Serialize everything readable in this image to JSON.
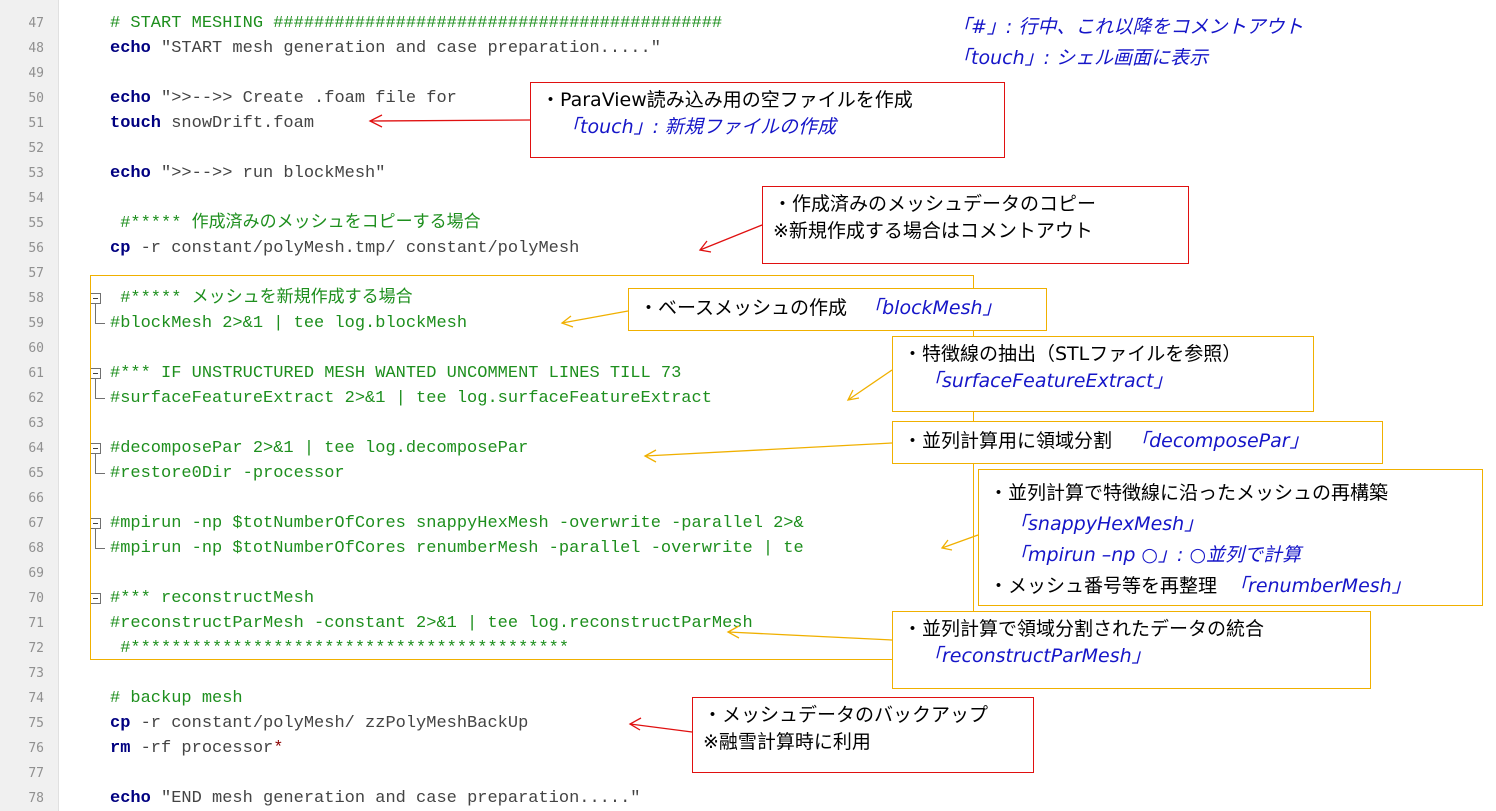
{
  "line_numbers": [
    "47",
    "48",
    "49",
    "50",
    "51",
    "52",
    "53",
    "54",
    "55",
    "56",
    "57",
    "58",
    "59",
    "60",
    "61",
    "62",
    "63",
    "64",
    "65",
    "66",
    "67",
    "68",
    "69",
    "70",
    "71",
    "72",
    "73",
    "74",
    "75",
    "76",
    "77",
    "78"
  ],
  "code": {
    "l47": "# START MESHING ############################################",
    "l48_kw": "echo",
    "l48_rest": " \"START mesh generation and case preparation.....\"",
    "l50_kw": "echo",
    "l50_rest": " \">>-->> Create .foam file for",
    "l51_kw": "touch",
    "l51_rest": " snowDrift.foam",
    "l53_kw": "echo",
    "l53_rest": " \">>-->> run blockMesh\"",
    "l55": " #***** 作成済みのメッシュをコピーする場合",
    "l56_kw": "cp",
    "l56_rest": " -r constant/polyMesh.tmp/ constant/polyMesh",
    "l58": " #***** メッシュを新規作成する場合",
    "l59": "#blockMesh 2>&1 | tee log.blockMesh",
    "l61": "#*** IF UNSTRUCTURED MESH WANTED UNCOMMENT LINES TILL 73",
    "l62": "#surfaceFeatureExtract 2>&1 | tee log.surfaceFeatureExtract",
    "l64": "#decomposePar 2>&1 | tee log.decomposePar",
    "l65": "#restore0Dir -processor",
    "l67": "#mpirun -np $totNumberOfCores snappyHexMesh -overwrite -parallel 2>&",
    "l68": "#mpirun -np $totNumberOfCores renumberMesh -parallel -overwrite | te",
    "l70": "#*** reconstructMesh",
    "l71": "#reconstructParMesh -constant 2>&1 | tee log.reconstructParMesh",
    "l72": " #*******************************************",
    "l74": "# backup mesh",
    "l75_kw": "cp",
    "l75_rest": " -r constant/polyMesh/ zzPolyMeshBackUp",
    "l76_kw": "rm",
    "l76_rest": " -rf processor",
    "l76_star": "*",
    "l78_kw": "echo",
    "l78_rest": " \"END mesh generation and case preparation.....\""
  },
  "notes": {
    "top1": "「#」: 行中、これ以降をコメントアウト",
    "top2": "「touch」: シェル画面に表示",
    "touch_1": "・ParaView読み込み用の空ファイルを作成",
    "touch_2": "「touch」: 新規ファイルの作成",
    "copy_1": "・作成済みのメッシュデータのコピー",
    "copy_2": "※新規作成する場合はコメントアウト",
    "base_1": "・ベースメッシュの作成",
    "base_2": "「blockMesh」",
    "feat_1": "・特徴線の抽出（STLファイルを参照）",
    "feat_2": "「surfaceFeatureExtract」",
    "decomp_1": "・並列計算用に領域分割",
    "decomp_2": "「decomposePar」",
    "snappy_1": "・並列計算で特徴線に沿ったメッシュの再構築",
    "snappy_2": "「snappyHexMesh」",
    "snappy_3": "「mpirun –np ○」: ○並列で計算",
    "snappy_4": "・メッシュ番号等を再整理",
    "snappy_5": "「renumberMesh」",
    "recon_1": "・並列計算で領域分割されたデータの統合",
    "recon_2": "「reconstructParMesh」",
    "backup_1": "・メッシュデータのバックアップ",
    "backup_2": "※融雪計算時に利用"
  },
  "colors": {
    "red": "#e01010",
    "orange": "#f0b000",
    "blue_text": "#1515c8",
    "comment_green": "#1e8f1e",
    "keyword_navy": "#000080"
  }
}
